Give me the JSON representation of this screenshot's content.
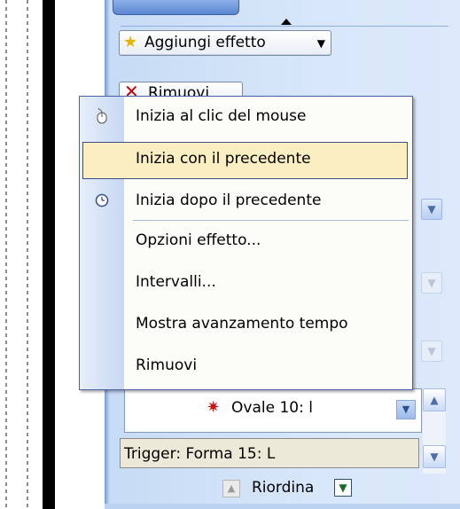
{
  "pane": {
    "add_effect": "Aggiungi effetto",
    "remove": "Rimuovi",
    "list_item": "Ovale 10: l",
    "trigger": "Trigger: Forma 15: L",
    "reorder": "Riordina"
  },
  "context_menu": {
    "items": [
      {
        "label": "Inizia al clic del mouse",
        "icon": "mouse-icon"
      },
      {
        "label": "Inizia con il precedente",
        "highlighted": true
      },
      {
        "label": "Inizia dopo il precedente",
        "icon": "clock-icon"
      },
      {
        "label": "Opzioni effetto..."
      },
      {
        "label": "Intervalli..."
      },
      {
        "label": "Mostra avanzamento tempo"
      },
      {
        "label": "Rimuovi"
      }
    ]
  },
  "colors": {
    "pane": "#d8e7fa",
    "menu_highlight": "#fbeec2",
    "menu_border": "#4a63a8"
  }
}
